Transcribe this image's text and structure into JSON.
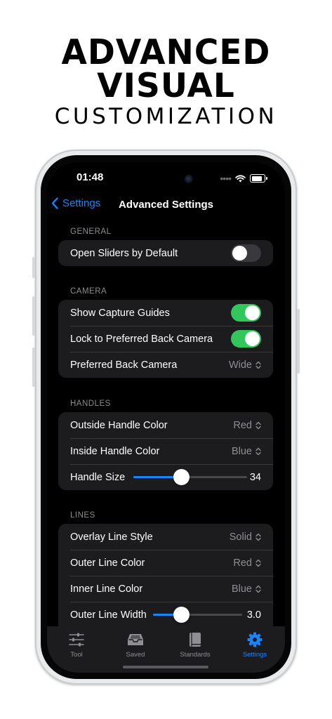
{
  "headline": {
    "line1": "ADVANCED",
    "line2": "VISUAL",
    "line3": "CUSTOMIZATION"
  },
  "status": {
    "time": "01:48",
    "dots": "••••"
  },
  "nav": {
    "back_label": "Settings",
    "title": "Advanced Settings"
  },
  "sections": {
    "general": {
      "label": "GENERAL",
      "open_sliders": {
        "label": "Open Sliders by Default",
        "on": false
      }
    },
    "camera": {
      "label": "CAMERA",
      "capture_guides": {
        "label": "Show Capture Guides",
        "on": true
      },
      "lock_back": {
        "label": "Lock to Preferred Back Camera",
        "on": true
      },
      "preferred_back": {
        "label": "Preferred Back Camera",
        "value": "Wide"
      }
    },
    "handles": {
      "label": "HANDLES",
      "outside_color": {
        "label": "Outside Handle Color",
        "value": "Red"
      },
      "inside_color": {
        "label": "Inside Handle Color",
        "value": "Blue"
      },
      "size": {
        "label": "Handle Size",
        "value": "34",
        "fraction": 0.42
      }
    },
    "lines": {
      "label": "LINES",
      "overlay_style": {
        "label": "Overlay Line Style",
        "value": "Solid"
      },
      "outer_color": {
        "label": "Outer Line Color",
        "value": "Red"
      },
      "inner_color": {
        "label": "Inner Line Color",
        "value": "Blue"
      },
      "outer_width": {
        "label": "Outer Line Width",
        "value": "3.0",
        "fraction": 0.32
      }
    }
  },
  "tabs": [
    {
      "label": "Tool",
      "icon": "sliders-icon"
    },
    {
      "label": "Saved",
      "icon": "tray-icon"
    },
    {
      "label": "Standards",
      "icon": "book-icon"
    },
    {
      "label": "Settings",
      "icon": "gear-icon"
    }
  ],
  "colors": {
    "accent": "#1a84ff",
    "toggle_on": "#32c75a",
    "group_bg": "#1c1c1e"
  }
}
